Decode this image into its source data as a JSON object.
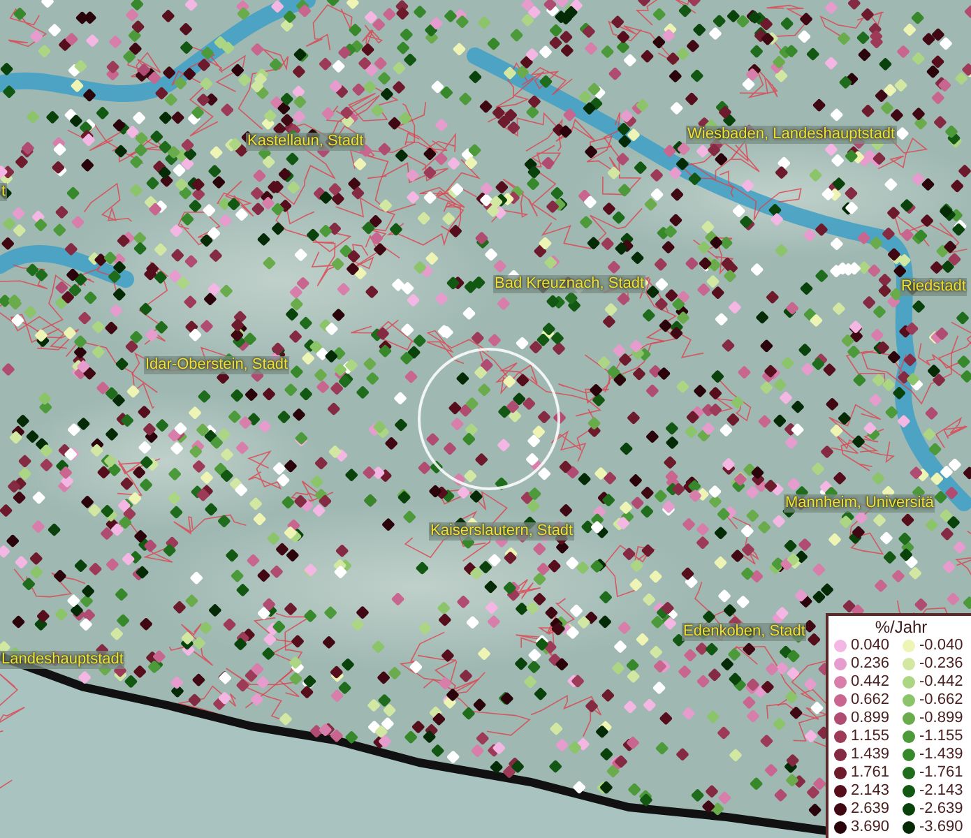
{
  "map": {
    "place_labels": [
      {
        "text": "t"
      },
      {
        "text": "Kastellaun, Stadt"
      },
      {
        "text": "Wiesbaden, Landeshauptstadt"
      },
      {
        "text": "Bad Kreuznach, Stadt"
      },
      {
        "text": "Riedstadt"
      },
      {
        "text": "Idar-Oberstein, Stadt"
      },
      {
        "text": "Mannheim, Universitä"
      },
      {
        "text": "Kaiserslautern, Stadt"
      },
      {
        "text": "Edenkoben, Stadt"
      },
      {
        "text": "Landeshauptstadt"
      }
    ]
  },
  "legend": {
    "title": "%/Jahr",
    "items": [
      {
        "label": "0.040",
        "color": "#f4b6e2"
      },
      {
        "label": "-0.040",
        "color": "#eef4b4"
      },
      {
        "label": "0.236",
        "color": "#e69ccc"
      },
      {
        "label": "-0.236",
        "color": "#d2e8a2"
      },
      {
        "label": "0.442",
        "color": "#d87eaa"
      },
      {
        "label": "-0.442",
        "color": "#acd684"
      },
      {
        "label": "0.662",
        "color": "#c86690"
      },
      {
        "label": "-0.662",
        "color": "#8cc46a"
      },
      {
        "label": "0.899",
        "color": "#b04c72"
      },
      {
        "label": "-0.899",
        "color": "#6aac4c"
      },
      {
        "label": "1.155",
        "color": "#9c3a58"
      },
      {
        "label": "-1.155",
        "color": "#4c9a3a"
      },
      {
        "label": "1.439",
        "color": "#842a42"
      },
      {
        "label": "-1.439",
        "color": "#36882a"
      },
      {
        "label": "1.761",
        "color": "#6c1a2c"
      },
      {
        "label": "-1.761",
        "color": "#1e6c1c"
      },
      {
        "label": "2.143",
        "color": "#560e1c"
      },
      {
        "label": "-2.143",
        "color": "#125812"
      },
      {
        "label": "2.639",
        "color": "#400812"
      },
      {
        "label": "-2.639",
        "color": "#0a420c"
      },
      {
        "label": "3.690",
        "color": "#2a040a"
      },
      {
        "label": "-3.690",
        "color": "#052a06"
      }
    ]
  }
}
